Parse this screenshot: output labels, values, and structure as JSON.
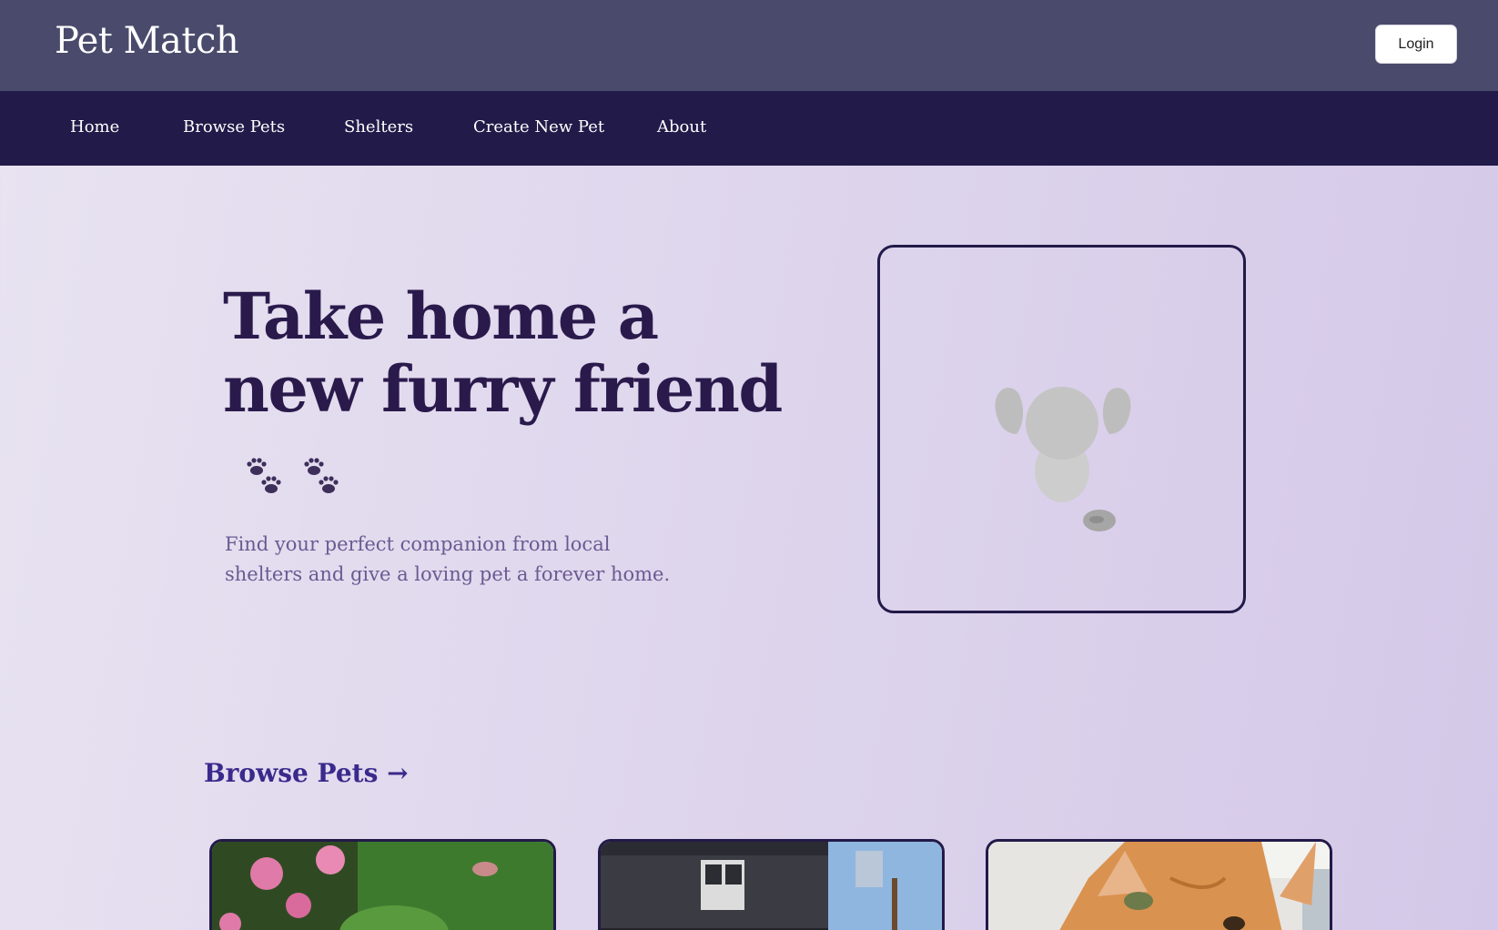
{
  "header": {
    "brand": "Pet Match",
    "login_label": "Login"
  },
  "nav": {
    "items": [
      {
        "label": "Home"
      },
      {
        "label": "Browse Pets"
      },
      {
        "label": "Shelters"
      },
      {
        "label": "Create New Pet"
      },
      {
        "label": "About"
      }
    ]
  },
  "hero": {
    "title_line1": "Take home a",
    "title_line2": "new furry friend",
    "subtitle_line1": "Find your perfect companion from local",
    "subtitle_line2": "shelters and give a loving pet a forever home.",
    "paw_icons": [
      "paw-print-icon",
      "paw-print-icon"
    ],
    "image": "pet-illustration-placeholder"
  },
  "browse": {
    "title": "Browse Pets →",
    "cards": [
      {
        "image": "dog-photo-flowers"
      },
      {
        "image": "dog-photo-house"
      },
      {
        "image": "orange-cat-photo"
      }
    ]
  },
  "colors": {
    "topbar": "#4a4a6c",
    "navbar": "#221a48",
    "title": "#2a1a4c",
    "subtitle": "#6b5a92",
    "link": "#3a2a8c"
  }
}
